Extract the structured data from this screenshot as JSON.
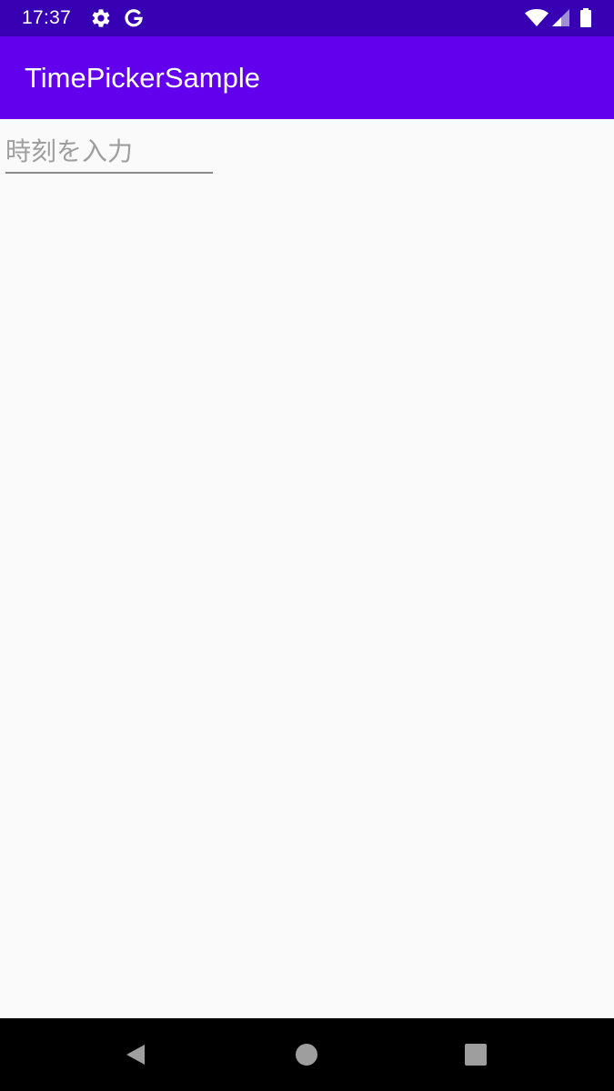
{
  "status_bar": {
    "time": "17:37",
    "left_icons": [
      "gear-icon",
      "google-g-icon"
    ],
    "right_icons": [
      "wifi-icon",
      "signal-icon",
      "battery-icon"
    ],
    "background_color": "#3700b3"
  },
  "app_bar": {
    "title": "TimePickerSample",
    "background_color": "#6200ee"
  },
  "time_field": {
    "placeholder": "時刻を入力",
    "value": ""
  },
  "nav_bar": {
    "buttons": [
      "back-icon",
      "home-icon",
      "recents-icon"
    ]
  }
}
